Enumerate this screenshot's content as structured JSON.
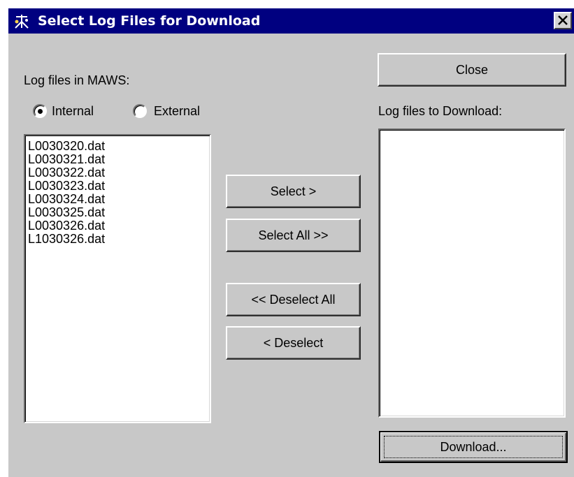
{
  "window": {
    "title": "Select Log Files for Download",
    "title_icon": "maws-station-icon",
    "close_icon": "close-icon"
  },
  "left_panel": {
    "heading": "Log files in MAWS:",
    "radio_internal": "Internal",
    "radio_external": "External",
    "selected_source": "Internal",
    "files": [
      "L0030320.dat",
      "L0030321.dat",
      "L0030322.dat",
      "L0030323.dat",
      "L0030324.dat",
      "L0030325.dat",
      "L0030326.dat",
      "L1030326.dat"
    ]
  },
  "middle": {
    "select": "Select >",
    "select_all": "Select All >>",
    "deselect_all": "<< Deselect All",
    "deselect": "< Deselect"
  },
  "right_panel": {
    "close": "Close",
    "heading": "Log files to Download:",
    "download": "Download..."
  },
  "colors": {
    "title_bar": "#000080",
    "dialog_face": "#c8c8c8"
  }
}
